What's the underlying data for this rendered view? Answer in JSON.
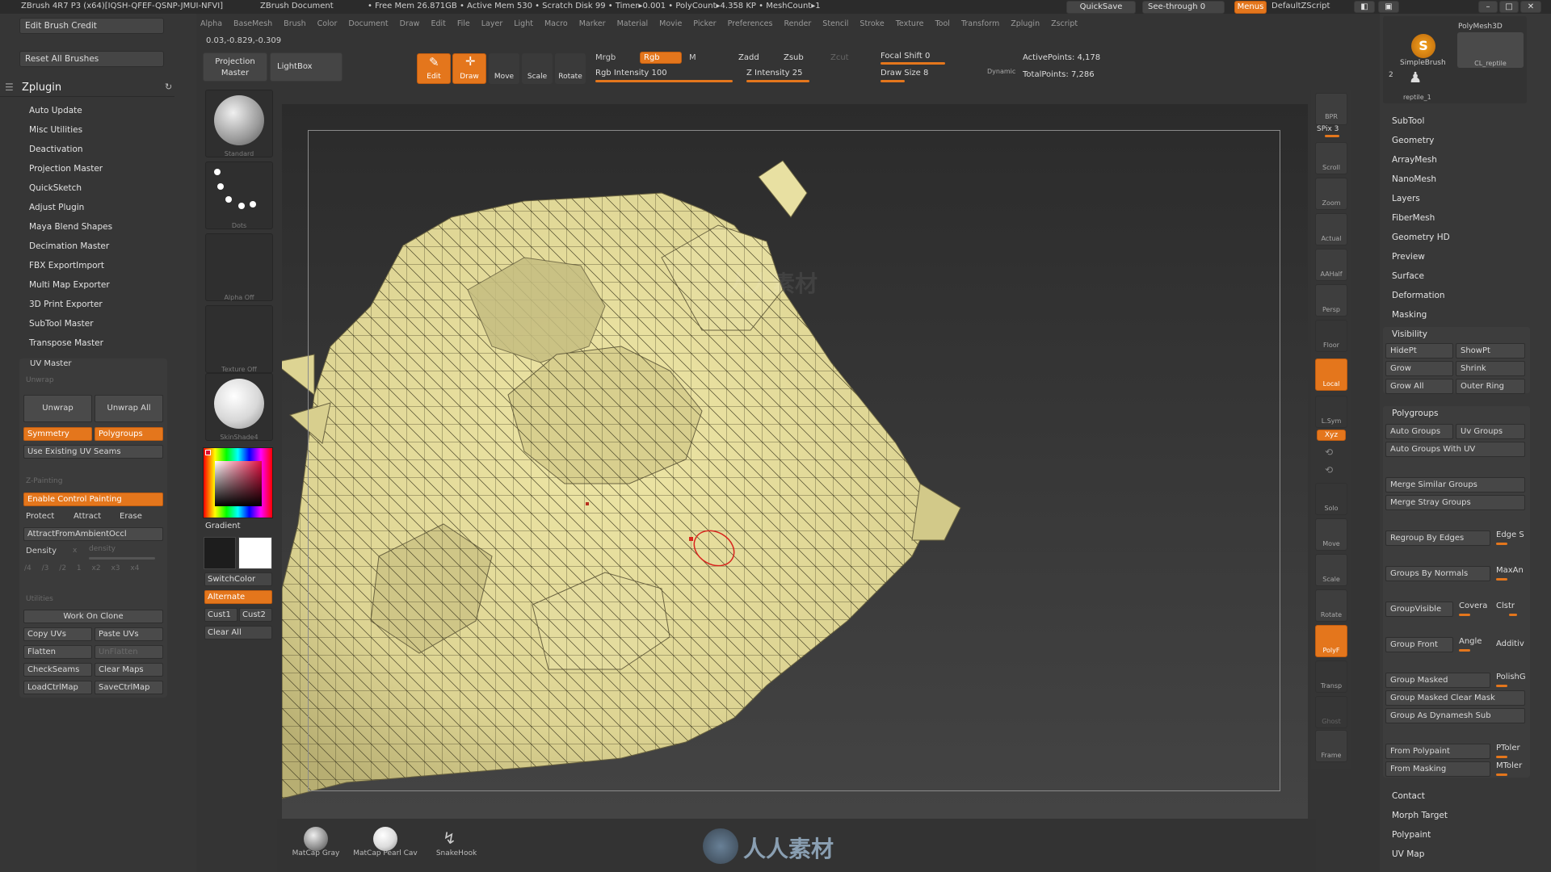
{
  "titlebar": {
    "app": "ZBrush 4R7 P3 (x64)[IQSH-QFEF-QSNP-JMUI-NFVI]",
    "doc": "ZBrush Document",
    "stats": "• Free Mem 26.871GB • Active Mem 530 • Scratch Disk 99 • Timer▸0.001 • PolyCount▸4.358 KP • MeshCount▸1",
    "quicksave": "QuickSave",
    "seethrough": "See-through",
    "seethrough_val": "0",
    "menus": "Menus",
    "script": "DefaultZScript"
  },
  "menubar": [
    "Alpha",
    "BaseMesh",
    "Brush",
    "Color",
    "Document",
    "Draw",
    "Edit",
    "File",
    "Layer",
    "Light",
    "Macro",
    "Marker",
    "Material",
    "Movie",
    "Picker",
    "Preferences",
    "Render",
    "Stencil",
    "Stroke",
    "Texture",
    "Tool",
    "Transform",
    "Zplugin",
    "Zscript"
  ],
  "coords": "0.03,-0.829,-0.309",
  "top": {
    "projection_master": "Projection Master",
    "lightbox": "LightBox",
    "edit": "Edit",
    "draw": "Draw",
    "move": "Move",
    "scale": "Scale",
    "rotate": "Rotate",
    "mrgb": "Mrgb",
    "rgb": "Rgb",
    "m": "M",
    "rgb_intensity": "Rgb Intensity 100",
    "zadd": "Zadd",
    "zsub": "Zsub",
    "zcut": "Zcut",
    "z_intensity": "Z Intensity 25",
    "focal_shift": "Focal Shift 0",
    "draw_size": "Draw Size 8",
    "dynamic": "Dynamic",
    "active_points": "ActivePoints: 4,178",
    "total_points": "TotalPoints: 7,286"
  },
  "left": {
    "edit_brush_credit": "Edit Brush Credit",
    "reset_all_brushes": "Reset All Brushes",
    "zplugin": "Zplugin",
    "items": [
      "Auto Update",
      "Misc Utilities",
      "Deactivation",
      "Projection Master",
      "QuickSketch",
      "Adjust Plugin",
      "Maya Blend Shapes",
      "Decimation Master",
      "FBX ExportImport",
      "Multi Map Exporter",
      "3D Print Exporter",
      "SubTool Master",
      "Transpose Master"
    ],
    "uv": {
      "title": "UV Master",
      "unwrap_hdr": "Unwrap",
      "unwrap": "Unwrap",
      "unwrap_all": "Unwrap All",
      "symmetry": "Symmetry",
      "polygroups": "Polygroups",
      "use_existing": "Use Existing UV Seams",
      "painting_hdr": "Z-Painting",
      "enable_cp": "Enable Control Painting",
      "protect": "Protect",
      "attract": "Attract",
      "erase": "Erase",
      "attract_ao": "AttractFromAmbientOccl",
      "density": "Density",
      "density_x": "x",
      "density_val": "density",
      "dens_btns": [
        "/4",
        "/3",
        "/2",
        "1",
        "x2",
        "x3",
        "x4"
      ],
      "utilities_hdr": "Utilities",
      "work_on_clone": "Work On Clone",
      "copy_uvs": "Copy UVs",
      "paste_uvs": "Paste UVs",
      "flatten": "Flatten",
      "unflatten": "UnFlatten",
      "checkseams": "CheckSeams",
      "clear_maps": "Clear Maps",
      "loadctrlmap": "LoadCtrlMap",
      "savectrlmap": "SaveCtrlMap"
    }
  },
  "tray": {
    "standard": "Standard",
    "dots": "Dots",
    "alpha_off": "Alpha Off",
    "texture_off": "Texture Off",
    "skinshade": "SkinShade4",
    "gradient": "Gradient",
    "switchcolor": "SwitchColor",
    "alternate": "Alternate",
    "cust1": "Cust1",
    "cust2": "Cust2",
    "clear_all": "Clear All"
  },
  "shelf": [
    "BPR",
    "SPix 3",
    "Scroll",
    "Zoom",
    "Actual",
    "AAHalf",
    "Persp",
    "Floor",
    "Local",
    "L.Sym",
    "Xyz",
    "",
    "",
    "Solo",
    "Move",
    "Scale",
    "Rotate",
    "PolyF",
    "Transp",
    "Ghost",
    "Frame"
  ],
  "right": {
    "tools": [
      "PolyMesh3D",
      "SimpleBrush",
      "CL_reptile",
      "reptile_1"
    ],
    "tool_count": "2",
    "items": [
      "SubTool",
      "Geometry",
      "ArrayMesh",
      "NanoMesh",
      "Layers",
      "FiberMesh",
      "Geometry HD",
      "Preview",
      "Surface",
      "Deformation",
      "Masking",
      "Visibility"
    ],
    "vis": {
      "hidept": "HidePt",
      "showpt": "ShowPt",
      "grow": "Grow",
      "shrink": "Shrink",
      "grow_all": "Grow All",
      "outer_ring": "Outer Ring"
    },
    "poly": {
      "title": "Polygroups",
      "auto_groups": "Auto Groups",
      "uv_groups": "Uv Groups",
      "auto_groups_uv": "Auto Groups With UV",
      "merge_similar": "Merge Similar Groups",
      "merge_stray": "Merge Stray Groups",
      "regroup_edges": "Regroup By Edges",
      "edge_s": "Edge S",
      "groups_normals": "Groups By Normals",
      "maxan": "MaxAn",
      "groupvisible": "GroupVisible",
      "covera": "Covera",
      "clstr": "Clstr",
      "group_front": "Group Front",
      "angle": "Angle",
      "additiv": "Additiv",
      "group_masked": "Group Masked",
      "polishg": "PolishG",
      "group_masked_clear": "Group Masked Clear Mask",
      "group_dynamesh": "Group As Dynamesh Sub",
      "from_polypaint": "From Polypaint",
      "ptoler": "PToler",
      "from_masking": "From Masking",
      "mtoler": "MToler"
    },
    "bottom_items": [
      "Contact",
      "Morph Target",
      "Polypaint",
      "UV Map"
    ]
  },
  "bottom": {
    "matcaps": [
      "MatCap Gray",
      "MatCap Pearl Cav",
      "SnakeHook"
    ],
    "watermark": "人人素材"
  },
  "colors": {
    "accent": "#e4761c",
    "mesh": "#e9e1a0"
  }
}
